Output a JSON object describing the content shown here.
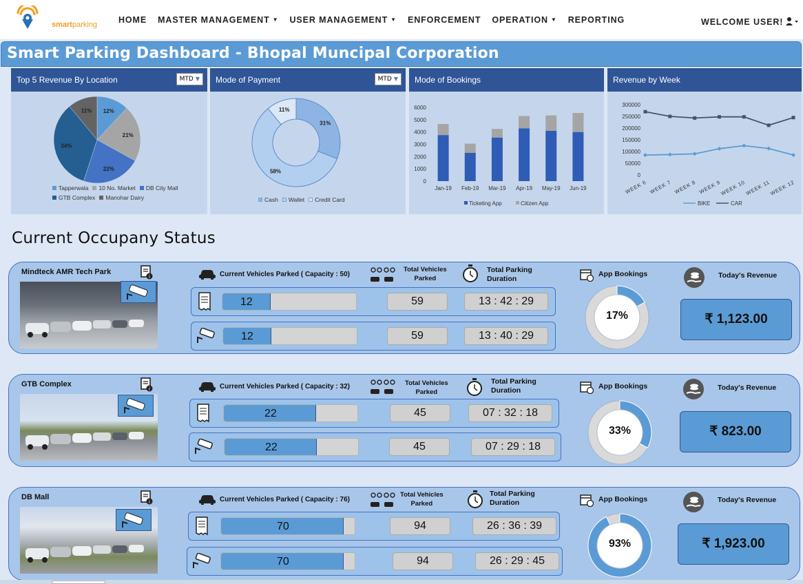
{
  "logo": {
    "text_a": "smart",
    "text_b": "parking"
  },
  "nav": {
    "items": [
      {
        "label": "HOME",
        "dropdown": false
      },
      {
        "label": "MASTER MANAGEMENT",
        "dropdown": true
      },
      {
        "label": "USER MANAGEMENT",
        "dropdown": true
      },
      {
        "label": "ENFORCEMENT",
        "dropdown": false
      },
      {
        "label": "OPERATION",
        "dropdown": true
      },
      {
        "label": "REPORTING",
        "dropdown": false
      }
    ],
    "welcome": "WELCOME USER!"
  },
  "page_title": "Smart Parking Dashboard - Bhopal Muncipal Corporation",
  "panels": {
    "revenue_location": {
      "title": "Top 5 Revenue By Location",
      "filter": "MTD"
    },
    "payment": {
      "title": "Mode of Payment",
      "filter": "MTD"
    },
    "bookings": {
      "title": "Mode of Bookings"
    },
    "revenue_week": {
      "title": "Revenue by Week"
    }
  },
  "chart_data": [
    {
      "type": "pie",
      "title": "Top 5 Revenue By Location",
      "categories": [
        "Tapperwala",
        "10 No. Market",
        "DB City Mall",
        "GTB Complex",
        "Manohar Dairy"
      ],
      "values": [
        12,
        21,
        22,
        34,
        11
      ],
      "labels": [
        "12%",
        "21%",
        "22%",
        "34%",
        "11%"
      ],
      "colors": [
        "#5b9bd5",
        "#a5a5a5",
        "#4472c4",
        "#255e91",
        "#636363"
      ]
    },
    {
      "type": "pie",
      "title": "Mode of Payment",
      "categories": [
        "Cash",
        "Wallet",
        "Credit Card"
      ],
      "values": [
        31,
        58,
        11
      ],
      "labels": [
        "31%",
        "58%",
        "11%"
      ],
      "colors": [
        "#8eb4e3",
        "#b3cff0",
        "#dce8f6"
      ]
    },
    {
      "type": "bar",
      "title": "Mode of Bookings",
      "categories": [
        "Jan-19",
        "Feb-19",
        "Mar-19",
        "Apr-19",
        "May-19",
        "Jun-19"
      ],
      "series": [
        {
          "name": "Ticketing App",
          "values": [
            3750,
            2300,
            3550,
            4300,
            4100,
            4000
          ],
          "color": "#2f5cb5"
        },
        {
          "name": "Citizen App",
          "values": [
            900,
            750,
            700,
            1000,
            1250,
            1550
          ],
          "color": "#a5a5a5"
        }
      ],
      "yticks": [
        "0",
        "1000",
        "2000",
        "3000",
        "4000",
        "5000",
        "6000"
      ],
      "ylim": [
        0,
        6000
      ]
    },
    {
      "type": "line",
      "title": "Revenue by Week",
      "categories": [
        "WEEK 6",
        "WEEK 7",
        "WEEK 8",
        "WEEK 9",
        "WEEK 10",
        "WEEK 11",
        "WEEK 12"
      ],
      "series": [
        {
          "name": "BIKE",
          "values": [
            85000,
            87000,
            90000,
            112000,
            125000,
            113000,
            85000
          ],
          "color": "#5b9bd5"
        },
        {
          "name": "CAR",
          "values": [
            270000,
            250000,
            243000,
            248000,
            248000,
            212000,
            245000
          ],
          "color": "#44546a"
        }
      ],
      "yticks": [
        "0",
        "50000",
        "100000",
        "150000",
        "200000",
        "250000",
        "300000"
      ],
      "ylim": [
        0,
        300000
      ]
    }
  ],
  "occupancy": {
    "title": "Current Occupany Status",
    "labels": {
      "total_vehicles": [
        "Total Vehicles",
        "Parked"
      ],
      "total_duration": [
        "Total Parking",
        "Duration"
      ],
      "app_bookings": "App Bookings",
      "todays_revenue": "Today's Revenue"
    },
    "locations": [
      {
        "name": "Mindteck AMR Tech Park",
        "capacity_label": "Current Vehicles Parked ( Capacity : 50)",
        "row1": {
          "parked": "12",
          "fill": 0.36,
          "total": "59",
          "duration": "13 : 42 : 29"
        },
        "row2": {
          "parked": "12",
          "fill": 0.36,
          "total": "59",
          "duration": "13 : 40 : 29"
        },
        "app_bookings_pct": "17%",
        "app_bookings_value": 0.17,
        "revenue": "₹ 1,123.00"
      },
      {
        "name": "GTB Complex",
        "capacity_label": "Current Vehicles Parked ( Capacity : 32)",
        "row1": {
          "parked": "22",
          "fill": 0.69,
          "total": "45",
          "duration": "07 : 32 : 18"
        },
        "row2": {
          "parked": "22",
          "fill": 0.69,
          "total": "45",
          "duration": "07 : 29 : 18"
        },
        "app_bookings_pct": "33%",
        "app_bookings_value": 0.33,
        "revenue": "₹ 823.00"
      },
      {
        "name": "DB Mall",
        "capacity_label": "Current Vehicles Parked ( Capacity : 76)",
        "row1": {
          "parked": "70",
          "fill": 0.92,
          "total": "94",
          "duration": "26 : 36 : 39"
        },
        "row2": {
          "parked": "70",
          "fill": 0.92,
          "total": "94",
          "duration": "26 : 29 : 45"
        },
        "app_bookings_pct": "93%",
        "app_bookings_value": 0.93,
        "revenue": "₹ 1,923.00"
      }
    ]
  }
}
